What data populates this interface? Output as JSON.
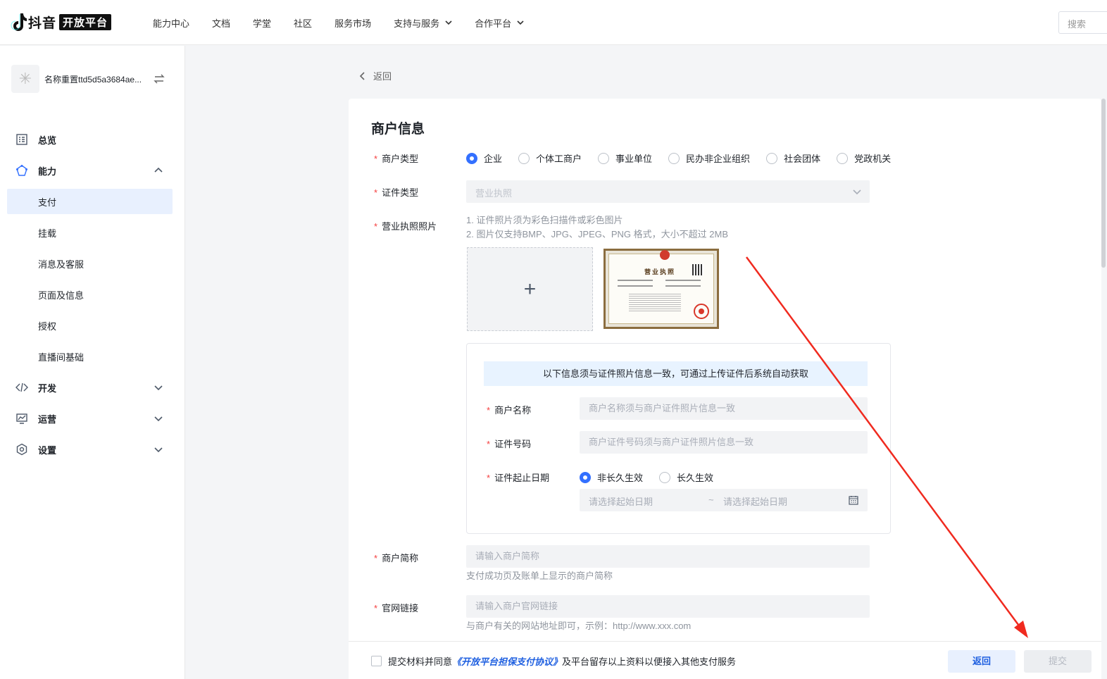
{
  "header": {
    "logo_text": "抖音",
    "logo_badge": "开放平台",
    "nav": [
      {
        "label": "能力中心"
      },
      {
        "label": "文档"
      },
      {
        "label": "学堂"
      },
      {
        "label": "社区"
      },
      {
        "label": "服务市场"
      },
      {
        "label": "支持与服务",
        "dropdown": true
      },
      {
        "label": "合作平台",
        "dropdown": true
      }
    ],
    "search_placeholder": "搜索"
  },
  "sidebar": {
    "app_name": "名称重置ttd5d5a3684ae...",
    "items": [
      {
        "label": "总览",
        "icon": "overview-icon"
      },
      {
        "label": "能力",
        "icon": "ability-icon",
        "expanded": true
      },
      {
        "label": "开发",
        "icon": "code-icon"
      },
      {
        "label": "运营",
        "icon": "operation-icon"
      },
      {
        "label": "设置",
        "icon": "settings-icon"
      }
    ],
    "sub_items": [
      "支付",
      "挂载",
      "消息及客服",
      "页面及信息",
      "授权",
      "直播间基础"
    ],
    "active_sub": "支付"
  },
  "back_label": "返回",
  "form": {
    "title": "商户信息",
    "merchant_type_label": "商户类型",
    "merchant_types": [
      "企业",
      "个体工商户",
      "事业单位",
      "民办非企业组织",
      "社会团体",
      "党政机关"
    ],
    "merchant_type_selected": "企业",
    "cert_type_label": "证件类型",
    "cert_type_value": "营业执照",
    "license_photo_label": "营业执照照片",
    "license_hint_1": "1. 证件照片须为彩色扫描件或彩色图片",
    "license_hint_2": "2. 图片仅支持BMP、JPG、JPEG、PNG 格式，大小不超过 2MB",
    "upload_plus": "+",
    "license_thumb_title": "营业执照",
    "notice": "以下信息须与证件照片信息一致，可通过上传证件后系统自动获取",
    "merchant_name_label": "商户名称",
    "merchant_name_placeholder": "商户名称须与商户证件照片信息一致",
    "cert_number_label": "证件号码",
    "cert_number_placeholder": "商户证件号码须与商户证件照片信息一致",
    "cert_date_label": "证件起止日期",
    "validity_options": [
      "非长久生效",
      "长久生效"
    ],
    "validity_selected": "非长久生效",
    "date_start_placeholder": "请选择起始日期",
    "date_sep": "~",
    "date_end_placeholder": "请选择起始日期",
    "short_name_label": "商户简称",
    "short_name_placeholder": "请输入商户简称",
    "short_name_hint": "支付成功页及账单上显示的商户简称",
    "website_label": "官网链接",
    "website_placeholder": "请输入商户官网链接",
    "website_hint": "与商户有关的网站地址即可，示例：http://www.xxx.com"
  },
  "footer": {
    "agree_prefix": "提交材料并同意",
    "agree_link": "《开放平台担保支付协议》",
    "agree_suffix": "及平台留存以上资料以便接入其他支付服务",
    "back_button": "返回",
    "submit_button": "提交"
  },
  "colors": {
    "primary": "#3370ff",
    "required": "#f53f3f",
    "annotation_arrow": "#f02a1f"
  }
}
